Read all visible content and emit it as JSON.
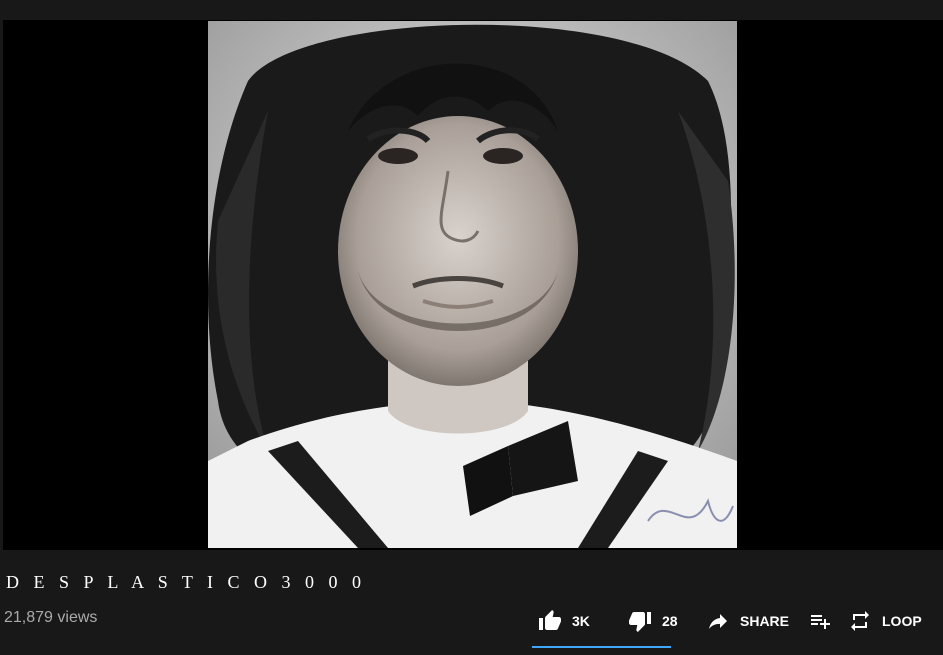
{
  "video": {
    "title": "D E S P L A S T I C O  3 0 0 0",
    "views": "21,879 views"
  },
  "actions": {
    "like_count": "3K",
    "dislike_count": "28",
    "share_label": "SHARE",
    "loop_label": "LOOP"
  },
  "icons": {
    "like": "thumb-up-icon",
    "dislike": "thumb-down-icon",
    "share": "share-arrow-icon",
    "save": "playlist-add-icon",
    "loop": "loop-icon",
    "more": "more-horizontal-icon"
  },
  "colors": {
    "background": "#181818",
    "player": "#000000",
    "accent": "#3ea6ff",
    "secondary_text": "#aaaaaa"
  },
  "sentiment": {
    "like_ratio": 0.99
  }
}
